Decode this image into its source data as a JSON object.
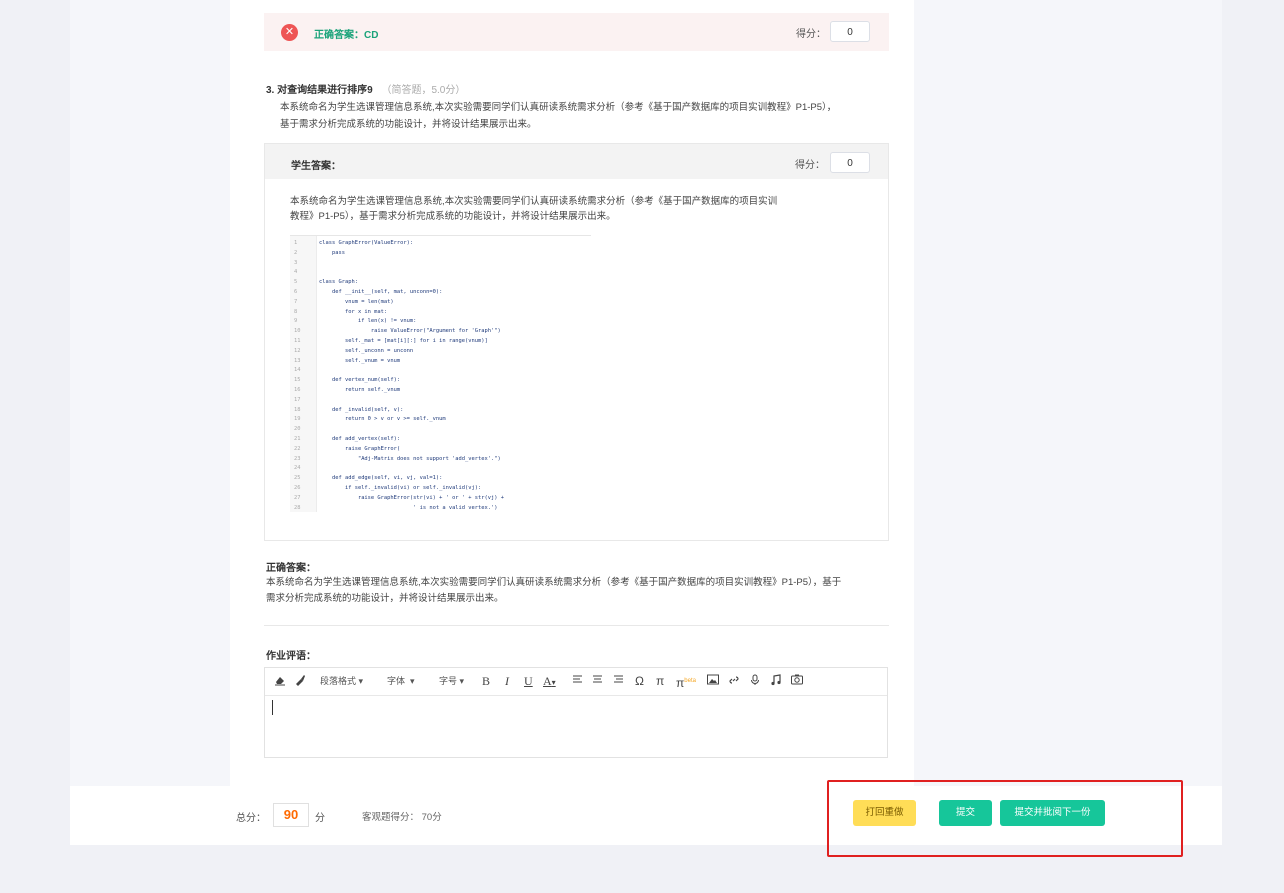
{
  "q2_result": {
    "correct_answer": "正确答案：CD",
    "score_label": "得分：",
    "score_value": "0"
  },
  "q3": {
    "number": "3.",
    "title": "对查询结果进行排序9",
    "meta": "（简答题，5.0分）",
    "body_line1": "本系统命名为学生选课管理信息系统,本次实验需要同学们认真研读系统需求分析（参考《基于国产数据库的项目实训教程》P1-P5），",
    "body_line2": "基于需求分析完成系统的功能设计，并将设计结果展示出来。"
  },
  "student_answer": {
    "label": "学生答案：",
    "score_label": "得分：",
    "score_value": "0",
    "text_line1": "本系统命名为学生选课管理信息系统,本次实验需要同学们认真研读系统需求分析（参考《基于国产数据库的项目实训",
    "text_line2": "教程》P1-P5），基于需求分析完成系统的功能设计，并将设计结果展示出来。",
    "code_lines": [
      {
        "n": "1",
        "t": "class GraphError(ValueError):"
      },
      {
        "n": "2",
        "t": "    pass"
      },
      {
        "n": "3",
        "t": ""
      },
      {
        "n": "4",
        "t": ""
      },
      {
        "n": "5",
        "t": "class Graph:"
      },
      {
        "n": "6",
        "t": "    def __init__(self, mat, unconn=0):"
      },
      {
        "n": "7",
        "t": "        vnum = len(mat)"
      },
      {
        "n": "8",
        "t": "        for x in mat:"
      },
      {
        "n": "9",
        "t": "            if len(x) != vnum:"
      },
      {
        "n": "10",
        "t": "                raise ValueError(\"Argument for 'Graph'\")"
      },
      {
        "n": "11",
        "t": "        self._mat = [mat[i][:] for i in range(vnum)]"
      },
      {
        "n": "12",
        "t": "        self._unconn = unconn"
      },
      {
        "n": "13",
        "t": "        self._vnum = vnum"
      },
      {
        "n": "14",
        "t": ""
      },
      {
        "n": "15",
        "t": "    def vertex_num(self):"
      },
      {
        "n": "16",
        "t": "        return self._vnum"
      },
      {
        "n": "17",
        "t": ""
      },
      {
        "n": "18",
        "t": "    def _invalid(self, v):"
      },
      {
        "n": "19",
        "t": "        return 0 > v or v >= self._vnum"
      },
      {
        "n": "20",
        "t": ""
      },
      {
        "n": "21",
        "t": "    def add_vertex(self):"
      },
      {
        "n": "22",
        "t": "        raise GraphError("
      },
      {
        "n": "23",
        "t": "            \"Adj-Matrix does not support 'add_vertex'.\")"
      },
      {
        "n": "24",
        "t": ""
      },
      {
        "n": "25",
        "t": "    def add_edge(self, vi, vj, val=1):"
      },
      {
        "n": "26",
        "t": "        if self._invalid(vi) or self._invalid(vj):"
      },
      {
        "n": "27",
        "t": "            raise GraphError(str(vi) + ' or ' + str(vj) +"
      },
      {
        "n": "28",
        "t": "                             ' is not a valid vertex.')"
      }
    ]
  },
  "correct_answer": {
    "label": "正确答案：",
    "line1": "本系统命名为学生选课管理信息系统,本次实验需要同学们认真研读系统需求分析（参考《基于国产数据库的项目实训教程》P1-P5），基于",
    "line2": "需求分析完成系统的功能设计，并将设计结果展示出来。"
  },
  "comment": {
    "label": "作业评语：",
    "toolbar": {
      "paragraph_format": "段落格式",
      "font": "字体",
      "font_size": "字号",
      "bold": "B",
      "italic": "I",
      "underline": "U",
      "font_color": "A",
      "omega": "Ω",
      "pi": "π",
      "pi_beta": "π",
      "beta": "beta"
    }
  },
  "footer": {
    "total_label": "总分：",
    "total_value": "90",
    "total_unit": "分",
    "objective_score": "客观题得分： 70分",
    "btn_return": "打回重做",
    "btn_submit": "提交",
    "btn_submit_next": "提交并批阅下一份"
  },
  "colors": {
    "accent_green": "#16c69a",
    "warning_yellow": "#ffdd57",
    "error_red": "#ee5555",
    "score_orange": "#ff6a00",
    "highlight_red": "#e02020"
  }
}
